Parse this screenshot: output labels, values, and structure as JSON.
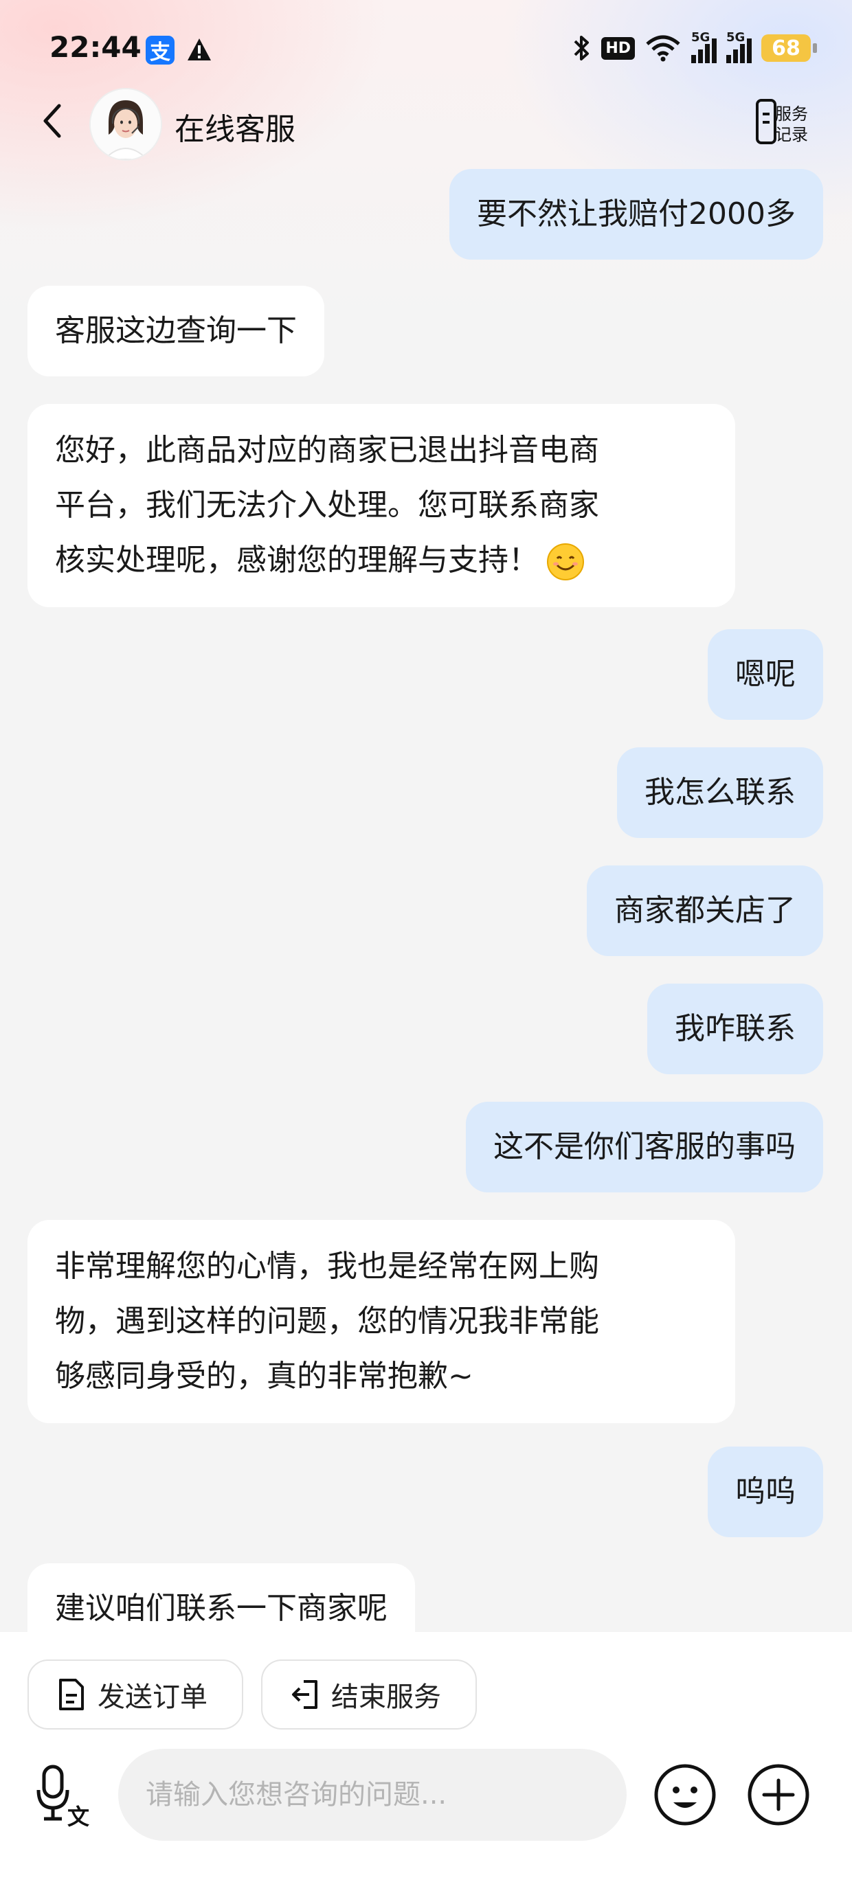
{
  "status_bar": {
    "time": "22:44",
    "alipay_glyph": "支",
    "hd_label": "HD",
    "network_label_1": "5G",
    "network_label_2": "5G",
    "battery": "68"
  },
  "header": {
    "title": "在线客服",
    "service_record_label_line1": "服务",
    "service_record_label_line2": "记录"
  },
  "messages": [
    {
      "side": "right",
      "text": "要不然让我赔付2000多"
    },
    {
      "side": "left",
      "text": "客服这边查询一下"
    },
    {
      "side": "left",
      "lines": [
        "您好，此商品对应的商家已退出抖音电商",
        "平台，我们无法介入处理。您可联系商家",
        "核实处理呢，感谢您的理解与支持！"
      ],
      "emoji": "smiling-face-emoji"
    },
    {
      "side": "right",
      "text": "嗯呢"
    },
    {
      "side": "right",
      "text": "我怎么联系"
    },
    {
      "side": "right",
      "text": "商家都关店了"
    },
    {
      "side": "right",
      "text": "我咋联系"
    },
    {
      "side": "right",
      "text": "这不是你们客服的事吗"
    },
    {
      "side": "left",
      "lines": [
        "非常理解您的心情，我也是经常在网上购",
        "物，遇到这样的问题，您的情况我非常能",
        "够感同身受的，真的非常抱歉~"
      ]
    },
    {
      "side": "right",
      "text": "呜呜"
    },
    {
      "side": "left",
      "text": "建议咱们联系一下商家呢"
    }
  ],
  "quick_actions": {
    "send_order": "发送订单",
    "end_service": "结束服务"
  },
  "input": {
    "placeholder": "请输入您想咨询的问题...",
    "voice_label": "文"
  },
  "colors": {
    "user_bubble": "#dbeafc",
    "agent_bubble": "#ffffff",
    "page_bg": "#f4f4f4",
    "battery": "#f5c542",
    "alipay": "#1677ff"
  }
}
